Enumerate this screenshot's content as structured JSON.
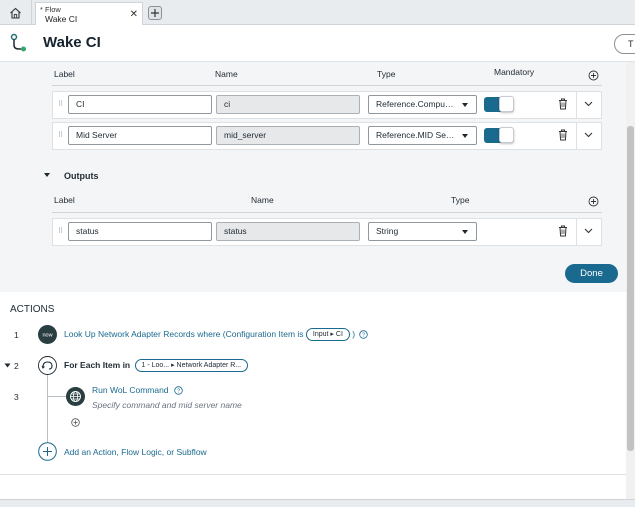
{
  "tab": {
    "marker": "*",
    "type_label": "Flow",
    "title": "Wake CI"
  },
  "header": {
    "title": "Wake CI",
    "right_button_label": "T"
  },
  "inputs_table": {
    "columns": {
      "label": "Label",
      "name": "Name",
      "type": "Type",
      "mandatory": "Mandatory"
    },
    "rows": [
      {
        "label": "CI",
        "name": "ci",
        "type": "Reference.Compu…",
        "mandatory": true
      },
      {
        "label": "Mid Server",
        "name": "mid_server",
        "type": "Reference.MID Se…",
        "mandatory": true
      }
    ]
  },
  "outputs": {
    "section_label": "Outputs",
    "columns": {
      "label": "Label",
      "name": "Name",
      "type": "Type"
    },
    "rows": [
      {
        "label": "status",
        "name": "status",
        "type": "String"
      }
    ]
  },
  "done_label": "Done",
  "actions": {
    "title": "ACTIONS",
    "steps": [
      {
        "num": "1",
        "text": "Look Up Network Adapter Records where (Configuration Item is",
        "pill_a": "Input",
        "pill_b": "CI",
        "close": ")"
      },
      {
        "num": "2",
        "text_prefix": "For Each Item in",
        "pill_a": "1 - Loo...",
        "pill_b": "Network Adapter R..."
      },
      {
        "num": "3",
        "title": "Run WoL Command",
        "subtitle": "Specify command and mid server name"
      }
    ],
    "add_label": "Add an Action, Flow Logic, or Subflow"
  },
  "colors": {
    "accent": "#1a6a8f",
    "panel": "#f4f5f6"
  }
}
